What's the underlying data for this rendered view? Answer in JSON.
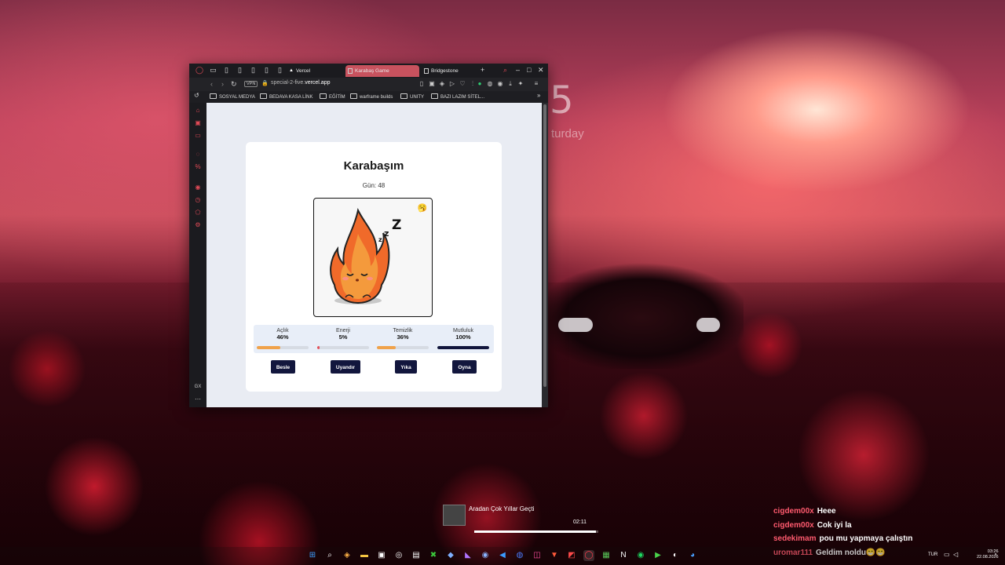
{
  "desktop": {
    "clock_digit": "5",
    "clock_day": "turday"
  },
  "browser": {
    "tabs": [
      {
        "label": "Vercel"
      },
      {
        "label": "Karabaş Game"
      },
      {
        "label": "Bridgestone"
      }
    ],
    "url_prefix": "special-2-five.",
    "url_domain": "vercel.app",
    "vpn_label": "VPN",
    "bookmarks": [
      {
        "label": "SOSYAL MEDYA"
      },
      {
        "label": "BEDAVA KASA LİNK"
      },
      {
        "label": "EĞİTİM"
      },
      {
        "label": "warframe builds"
      },
      {
        "label": "UNITY"
      },
      {
        "label": "BAZI LAZIM SİTEL..."
      }
    ],
    "sidebar_bottom": "GX"
  },
  "game": {
    "title": "Karabaşım",
    "day_label": "Gün: 48",
    "mood_emoji": "🥱",
    "stats": [
      {
        "label": "Açlık",
        "value": "46%",
        "level": 0.46,
        "color": "#f0a24a"
      },
      {
        "label": "Enerji",
        "value": "5%",
        "level": 0.05,
        "color": "#e4505a"
      },
      {
        "label": "Temizlik",
        "value": "36%",
        "level": 0.36,
        "color": "#f0a24a"
      },
      {
        "label": "Mutluluk",
        "value": "100%",
        "level": 1.0,
        "color": "#12163d"
      }
    ],
    "buttons": {
      "feed": "Besle",
      "wake": "Uyandır",
      "wash": "Yıka",
      "play": "Oyna"
    }
  },
  "media": {
    "song": "Aradan Çok Yıllar Geçti",
    "time": "02:11",
    "progress": 0.98
  },
  "chat": [
    {
      "user": "cigdem00x",
      "message": "Heee"
    },
    {
      "user": "cigdem00x",
      "message": "Cok iyi la"
    },
    {
      "user": "sedekimam",
      "message": "pou mu yapmaya çalıştın"
    },
    {
      "user": "uromar111",
      "message": "Geldim noldu😁😁"
    }
  ],
  "taskbar": {
    "language": "TUR",
    "time": "03:26",
    "date": "22.08.2026"
  }
}
